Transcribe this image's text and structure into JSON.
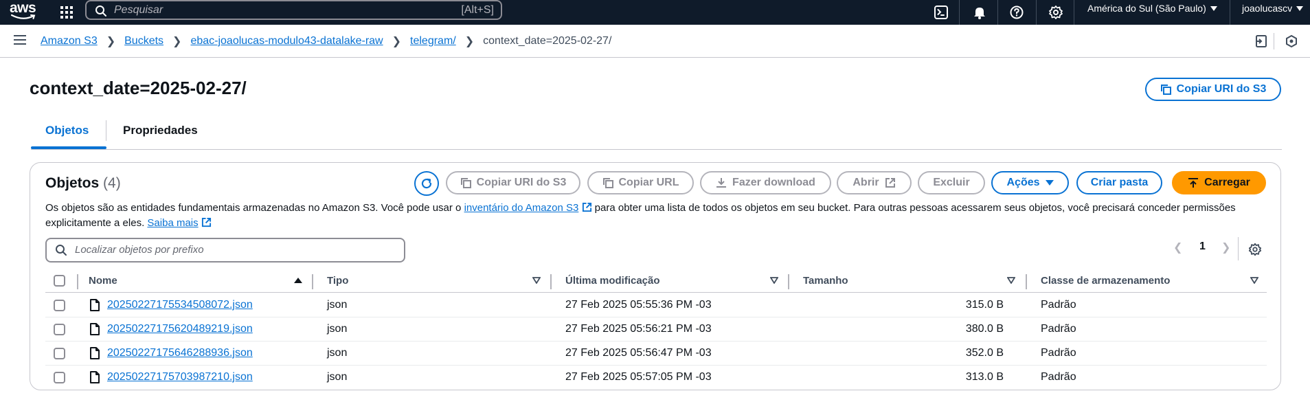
{
  "topnav": {
    "logo": "aws",
    "search_placeholder": "Pesquisar",
    "search_shortcut": "[Alt+S]",
    "region": "América do Sul (São Paulo)",
    "user": "joaolucascv",
    "icons": [
      "cloudshell-icon",
      "bell-icon",
      "help-icon",
      "gear-icon"
    ]
  },
  "breadcrumb": {
    "items": [
      "Amazon S3",
      "Buckets",
      "ebac-joaolucas-modulo43-datalake-raw",
      "telegram/"
    ],
    "current": "context_date=2025-02-27/"
  },
  "header": {
    "title": "context_date=2025-02-27/",
    "copy_uri_button": "Copiar URI do S3"
  },
  "tabs": [
    {
      "label": "Objetos",
      "active": true
    },
    {
      "label": "Propriedades",
      "active": false
    }
  ],
  "objects": {
    "title": "Objetos",
    "count": "(4)",
    "buttons": {
      "copy_uri": "Copiar URI do S3",
      "copy_url": "Copiar URL",
      "download": "Fazer download",
      "open": "Abrir",
      "delete": "Excluir",
      "actions": "Ações",
      "create_folder": "Criar pasta",
      "upload": "Carregar"
    },
    "description_1": "Os objetos são as entidades fundamentais armazenadas no Amazon S3. Você pode usar o ",
    "description_link": "inventário do Amazon S3",
    "description_2": " para obter uma lista de todos os objetos em seu bucket. Para outras pessoas acessarem seus objetos, você precisará conceder permissões explicitamente a eles. ",
    "learn_more": "Saiba mais",
    "filter_placeholder": "Localizar objetos por prefixo",
    "page": "1",
    "columns": [
      "Nome",
      "Tipo",
      "Última modificação",
      "Tamanho",
      "Classe de armazenamento"
    ],
    "rows": [
      {
        "name": "20250227175534508072.json",
        "type": "json",
        "modified": "27 Feb 2025 05:55:36 PM -03",
        "size": "315.0 B",
        "class": "Padrão"
      },
      {
        "name": "20250227175620489219.json",
        "type": "json",
        "modified": "27 Feb 2025 05:56:21 PM -03",
        "size": "380.0 B",
        "class": "Padrão"
      },
      {
        "name": "20250227175646288936.json",
        "type": "json",
        "modified": "27 Feb 2025 05:56:47 PM -03",
        "size": "352.0 B",
        "class": "Padrão"
      },
      {
        "name": "20250227175703987210.json",
        "type": "json",
        "modified": "27 Feb 2025 05:57:05 PM -03",
        "size": "313.0 B",
        "class": "Padrão"
      }
    ]
  },
  "colors": {
    "nav_bg": "#0f1b2a",
    "link": "#0972d3",
    "primary": "#ff9900",
    "border": "#c6c6cd"
  }
}
